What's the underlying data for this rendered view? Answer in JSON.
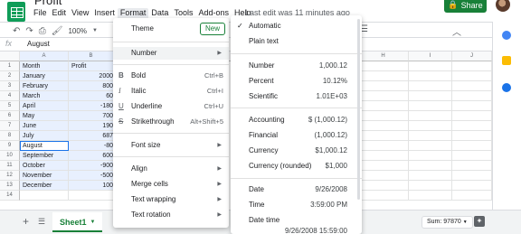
{
  "app": {
    "title": "Profit",
    "menus": [
      "File",
      "Edit",
      "View",
      "Insert",
      "Format",
      "Data",
      "Tools",
      "Add-ons",
      "Help"
    ],
    "last_edit": "Last edit was 11 minutes ago",
    "share_label": "Share"
  },
  "toolbar": {
    "zoom": "100%"
  },
  "formula_bar": {
    "fx": "fx",
    "value": "August"
  },
  "grid": {
    "columns": [
      "A",
      "B",
      "H",
      "I",
      "J"
    ],
    "rows": [
      {
        "n": "1",
        "a": "Month",
        "b": "Profit"
      },
      {
        "n": "2",
        "a": "January",
        "b": "2000"
      },
      {
        "n": "3",
        "a": "February",
        "b": "800"
      },
      {
        "n": "4",
        "a": "March",
        "b": "60"
      },
      {
        "n": "5",
        "a": "April",
        "b": "-180"
      },
      {
        "n": "6",
        "a": "May",
        "b": "700"
      },
      {
        "n": "7",
        "a": "June",
        "b": "190"
      },
      {
        "n": "8",
        "a": "July",
        "b": "687"
      },
      {
        "n": "9",
        "a": "August",
        "b": "-80"
      },
      {
        "n": "10",
        "a": "September",
        "b": "600"
      },
      {
        "n": "11",
        "a": "October",
        "b": "-900"
      },
      {
        "n": "12",
        "a": "November",
        "b": "-500"
      },
      {
        "n": "13",
        "a": "December",
        "b": "100"
      },
      {
        "n": "14",
        "a": "",
        "b": ""
      }
    ]
  },
  "format_menu": {
    "theme": "Theme",
    "new_badge": "New",
    "number": "Number",
    "bold": "Bold",
    "bold_sc": "Ctrl+B",
    "italic": "Italic",
    "italic_sc": "Ctrl+I",
    "underline": "Underline",
    "underline_sc": "Ctrl+U",
    "strikethrough": "Strikethrough",
    "strikethrough_sc": "Alt+Shift+5",
    "font_size": "Font size",
    "align": "Align",
    "merge_cells": "Merge cells",
    "text_wrapping": "Text wrapping",
    "text_rotation": "Text rotation"
  },
  "number_menu": {
    "automatic": "Automatic",
    "plain_text": "Plain text",
    "items": [
      {
        "label": "Number",
        "value": "1,000.12"
      },
      {
        "label": "Percent",
        "value": "10.12%"
      },
      {
        "label": "Scientific",
        "value": "1.01E+03"
      },
      {
        "label": "Accounting",
        "value": "$ (1,000.12)"
      },
      {
        "label": "Financial",
        "value": "(1,000.12)"
      },
      {
        "label": "Currency",
        "value": "$1,000.12"
      },
      {
        "label": "Currency (rounded)",
        "value": "$1,000"
      },
      {
        "label": "Date",
        "value": "9/26/2008"
      },
      {
        "label": "Time",
        "value": "3:59:00 PM"
      },
      {
        "label": "Date time",
        "value": "9/26/2008 15:59:00"
      }
    ]
  },
  "bottom": {
    "sheet_tab": "Sheet1",
    "sum": "Sum: 97870"
  },
  "colors": {
    "brand_green": "#188038",
    "selection_blue": "#e8f0fe",
    "active_border": "#1a73e8"
  }
}
